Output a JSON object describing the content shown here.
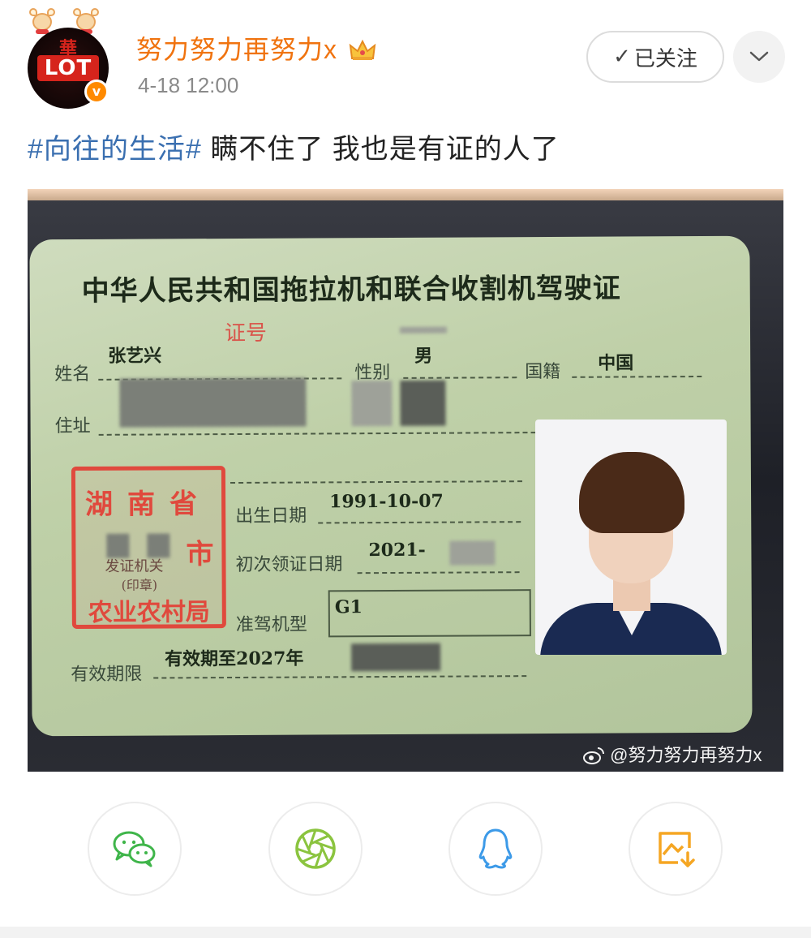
{
  "header": {
    "username": "努力努力再努力x",
    "timestamp": "4-18 12:00",
    "follow_label": "已关注",
    "avatar_logo_text": "LOT",
    "avatar_logo_cap": "華"
  },
  "post": {
    "hashtag": "#向往的生活#",
    "text": " 瞒不住了 我也是有证的人了"
  },
  "license_card": {
    "title": "中华人民共和国拖拉机和联合收割机驾驶证",
    "cert_no_label": "证号",
    "name_label": "姓名",
    "name_value": "张艺兴",
    "gender_label": "性别",
    "gender_value": "男",
    "nationality_label": "国籍",
    "nationality_value": "中国",
    "address_label": "住址",
    "birth_label": "出生日期",
    "birth_value": "1991-10-07",
    "first_issue_label": "初次领证日期",
    "first_issue_value": "2021-",
    "vehicle_label": "准驾机型",
    "vehicle_value": "G1",
    "validity_label": "有效期限",
    "validity_value": "有效期至2027年",
    "stamp_line1": "湖南省",
    "stamp_line2": "市",
    "stamp_line3": "发证机关",
    "stamp_line4": "(印章)",
    "stamp_line5": "农业农村局"
  },
  "watermark": "@努力努力再努力x",
  "share": [
    {
      "name": "wechat",
      "color": "#3fb54a"
    },
    {
      "name": "moments",
      "color": "#8bc43f"
    },
    {
      "name": "qq",
      "color": "#3c9ae8"
    },
    {
      "name": "save-image",
      "color": "#f5a623"
    }
  ]
}
